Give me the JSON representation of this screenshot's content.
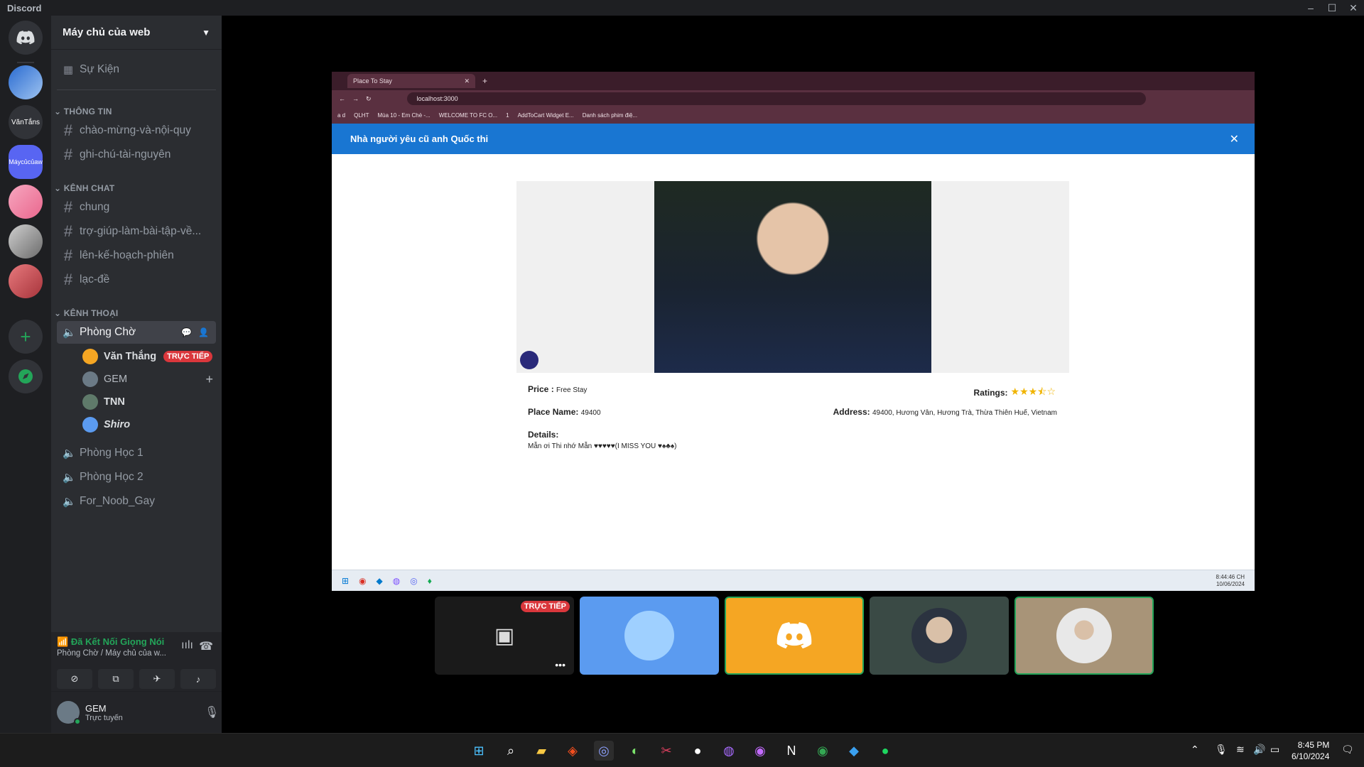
{
  "window": {
    "app_title": "Discord",
    "controls": [
      "–",
      "☐",
      "✕"
    ]
  },
  "servers": [
    {
      "label": "",
      "icon": "discord-icon"
    },
    {
      "label": "",
      "icon": "server-avatar"
    },
    {
      "label": "VănTắns"
    },
    {
      "label": "Máycủcủaw"
    },
    {
      "label": ""
    },
    {
      "label": ""
    },
    {
      "label": ""
    },
    {
      "label": "+"
    },
    {
      "label": ""
    }
  ],
  "sidebar": {
    "server_name": "Máy chủ của web",
    "events_label": "Sự Kiện",
    "categories": {
      "info": "THÔNG TIN",
      "chat": "KÊNH CHAT",
      "voice": "KÊNH THOẠI"
    },
    "info_channels": [
      "chào-mừng-và-nội-quy",
      "ghi-chú-tài-nguyên"
    ],
    "chat_channels": [
      "chung",
      "trợ-giúp-làm-bài-tập-về...",
      "lên-kế-hoạch-phiên",
      "lạc-đề"
    ],
    "voice_channels": [
      "Phòng Chờ",
      "Phòng Học 1",
      "Phòng Học 2",
      "For_Noob_Gay"
    ],
    "voice_users": [
      {
        "name": "Văn Thắng",
        "badge": "TRỰC TIẾP"
      },
      {
        "name": "GEM"
      },
      {
        "name": "TNN"
      },
      {
        "name": "Shiro"
      }
    ]
  },
  "voice_panel": {
    "status": "Đã Kết Nối Giọng Nói",
    "location": "Phòng Chờ / Máy chủ của w..."
  },
  "user_panel": {
    "name": "GEM",
    "status": "Trực tuyến"
  },
  "browser": {
    "tab_title": "Place To Stay",
    "url": "localhost:3000",
    "bookmarks": [
      "a d",
      "QLHT",
      "Mùa 10 - Em Chè -...",
      "WELCOME TO FC O...",
      "1",
      "AddToCart Widget E...",
      "Danh sách phim điệ..."
    ],
    "banner_title": "Nhà người yêu cũ anh Quốc thi",
    "listing": {
      "price_label": "Price :",
      "price_value": "Free Stay",
      "ratings_label": "Ratings:",
      "rating": 3.5,
      "place_label": "Place Name:",
      "place_value": "49400",
      "address_label": "Address:",
      "address_value": "49400, Hương Vân, Hương Trà, Thừa Thiên Huế, Vietnam",
      "details_label": "Details:",
      "details_value": "Mẫn ơi Thi nhớ Mẫn ♥♥♥♥♥(I MISS YOU ♥♠♣♠)"
    },
    "inner_clock": {
      "time": "8:44:46 CH",
      "date": "10/06/2024"
    }
  },
  "tiles": [
    {
      "name": "stream-tile",
      "badge": "TRỰC TIẾP",
      "bg": "#1a1a1a"
    },
    {
      "name": "avatar-anime",
      "bg": "#5b9bf0"
    },
    {
      "name": "discord-logo",
      "bg": "#f5a623"
    },
    {
      "name": "avatar-person",
      "bg": "#3a4a45"
    },
    {
      "name": "avatar-hoodie",
      "bg": "#a89478"
    }
  ],
  "taskbar": {
    "time": "8:45 PM",
    "date": "6/10/2024"
  },
  "colors": {
    "accent": "#5865f2",
    "live": "#da373c",
    "online": "#23a559",
    "banner": "#1976d2"
  }
}
